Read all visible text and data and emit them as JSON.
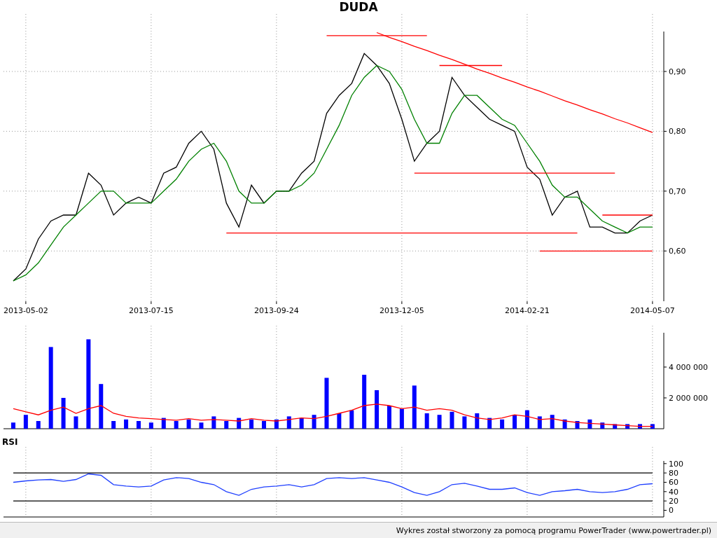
{
  "title": "DUDA",
  "price_panel": {
    "chart_data": {
      "type": "line",
      "grid": true,
      "categories": [
        null,
        "2013-05-02",
        null,
        null,
        null,
        null,
        null,
        null,
        null,
        null,
        null,
        "2013-07-15",
        null,
        null,
        null,
        null,
        null,
        null,
        null,
        null,
        null,
        "2013-09-24",
        null,
        null,
        null,
        null,
        null,
        null,
        null,
        null,
        null,
        "2013-12-05",
        null,
        null,
        null,
        null,
        null,
        null,
        null,
        null,
        null,
        "2014-02-21",
        null,
        null,
        null,
        null,
        null,
        null,
        null,
        null,
        null,
        "2014-05-07"
      ],
      "ylim": [
        0.516,
        0.996
      ],
      "yticks": [
        {
          "value": 0.6,
          "label": "0,60"
        },
        {
          "value": 0.7,
          "label": "0,70"
        },
        {
          "value": 0.8,
          "label": "0,80"
        },
        {
          "value": 0.9,
          "label": "0,90"
        }
      ],
      "series": [
        {
          "color": "#000000",
          "values": [
            0.55,
            0.57,
            0.62,
            0.65,
            0.66,
            0.66,
            0.73,
            0.71,
            0.66,
            0.68,
            0.69,
            0.68,
            0.73,
            0.74,
            0.78,
            0.8,
            0.77,
            0.68,
            0.64,
            0.71,
            0.68,
            0.7,
            0.7,
            0.73,
            0.75,
            0.83,
            0.86,
            0.88,
            0.93,
            0.91,
            0.88,
            0.82,
            0.75,
            0.78,
            0.8,
            0.89,
            0.86,
            0.84,
            0.82,
            0.81,
            0.8,
            0.74,
            0.72,
            0.66,
            0.69,
            0.7,
            0.64,
            0.64,
            0.63,
            0.63,
            0.65,
            0.66
          ]
        },
        {
          "color": "#008000",
          "values": [
            0.55,
            0.56,
            0.58,
            0.61,
            0.64,
            0.66,
            0.68,
            0.7,
            0.7,
            0.68,
            0.68,
            0.68,
            0.7,
            0.72,
            0.75,
            0.77,
            0.78,
            0.75,
            0.7,
            0.68,
            0.68,
            0.7,
            0.7,
            0.71,
            0.73,
            0.77,
            0.81,
            0.86,
            0.89,
            0.91,
            0.9,
            0.87,
            0.82,
            0.78,
            0.78,
            0.83,
            0.86,
            0.86,
            0.84,
            0.82,
            0.81,
            0.78,
            0.75,
            0.71,
            0.69,
            0.69,
            0.67,
            0.65,
            0.64,
            0.63,
            0.64,
            0.64
          ]
        },
        {
          "color": "#ff0000",
          "values": [
            null,
            null,
            null,
            null,
            null,
            null,
            null,
            null,
            null,
            null,
            null,
            null,
            null,
            null,
            null,
            null,
            null,
            null,
            null,
            null,
            null,
            null,
            null,
            null,
            null,
            0.96,
            0.96,
            0.96,
            0.96,
            0.96,
            0.96,
            0.96,
            0.96,
            0.96,
            null,
            null,
            null,
            null,
            null,
            null,
            null,
            null,
            null,
            null,
            null,
            null,
            null,
            null,
            null,
            null,
            null,
            null
          ]
        },
        {
          "color": "#ff0000",
          "values": [
            null,
            null,
            null,
            null,
            null,
            null,
            null,
            null,
            null,
            null,
            null,
            null,
            null,
            null,
            null,
            null,
            null,
            null,
            null,
            null,
            null,
            null,
            null,
            null,
            null,
            null,
            null,
            null,
            null,
            null,
            null,
            null,
            null,
            null,
            0.91,
            0.91,
            0.91,
            0.91,
            0.91,
            0.91,
            null,
            null,
            null,
            null,
            null,
            null,
            null,
            null,
            null,
            null,
            null,
            null
          ]
        },
        {
          "color": "#ff0000",
          "values": [
            null,
            null,
            null,
            null,
            null,
            null,
            null,
            null,
            null,
            null,
            null,
            null,
            null,
            null,
            null,
            null,
            null,
            null,
            null,
            null,
            null,
            null,
            null,
            null,
            null,
            null,
            null,
            null,
            null,
            0.965,
            0.957,
            0.95,
            0.942,
            0.935,
            0.927,
            0.92,
            0.912,
            0.904,
            0.897,
            0.889,
            0.882,
            0.874,
            0.867,
            0.859,
            0.851,
            0.844,
            0.836,
            0.829,
            0.821,
            0.814,
            0.806,
            0.798
          ]
        },
        {
          "color": "#ff0000",
          "values": [
            null,
            null,
            null,
            null,
            null,
            null,
            null,
            null,
            null,
            null,
            null,
            null,
            null,
            null,
            null,
            null,
            null,
            null,
            null,
            null,
            null,
            null,
            null,
            null,
            null,
            null,
            null,
            null,
            null,
            null,
            null,
            null,
            0.73,
            0.73,
            0.73,
            0.73,
            0.73,
            0.73,
            0.73,
            0.73,
            0.73,
            0.73,
            0.73,
            0.73,
            0.73,
            0.73,
            0.73,
            0.73,
            0.73,
            null,
            null,
            null
          ]
        },
        {
          "color": "#ff0000",
          "values": [
            null,
            null,
            null,
            null,
            null,
            null,
            null,
            null,
            null,
            null,
            null,
            null,
            null,
            null,
            null,
            null,
            null,
            0.63,
            0.63,
            0.63,
            0.63,
            0.63,
            0.63,
            0.63,
            0.63,
            0.63,
            0.63,
            0.63,
            0.63,
            0.63,
            0.63,
            0.63,
            0.63,
            0.63,
            0.63,
            0.63,
            0.63,
            0.63,
            0.63,
            0.63,
            0.63,
            0.63,
            0.63,
            0.63,
            0.63,
            0.63,
            null,
            null,
            null,
            null,
            null,
            null
          ]
        },
        {
          "color": "#ff0000",
          "values": [
            null,
            null,
            null,
            null,
            null,
            null,
            null,
            null,
            null,
            null,
            null,
            null,
            null,
            null,
            null,
            null,
            null,
            null,
            null,
            null,
            null,
            null,
            null,
            null,
            null,
            null,
            null,
            null,
            null,
            null,
            null,
            null,
            null,
            null,
            null,
            null,
            null,
            null,
            null,
            null,
            null,
            null,
            null,
            null,
            null,
            null,
            null,
            0.66,
            0.66,
            0.66,
            0.66,
            0.66
          ]
        },
        {
          "color": "#ff0000",
          "values": [
            null,
            null,
            null,
            null,
            null,
            null,
            null,
            null,
            null,
            null,
            null,
            null,
            null,
            null,
            null,
            null,
            null,
            null,
            null,
            null,
            null,
            null,
            null,
            null,
            null,
            null,
            null,
            null,
            null,
            null,
            null,
            null,
            null,
            null,
            null,
            null,
            null,
            null,
            null,
            null,
            null,
            null,
            0.6,
            0.6,
            0.6,
            0.6,
            0.6,
            0.6,
            0.6,
            0.6,
            0.6,
            0.6
          ]
        }
      ]
    }
  },
  "volume_panel": {
    "chart_data": {
      "type": "bar",
      "grid": true,
      "categories": [
        null,
        null,
        null,
        null,
        null,
        null,
        null,
        null,
        null,
        null,
        null,
        null,
        null,
        null,
        null,
        null,
        null,
        null,
        null,
        null,
        null,
        null,
        null,
        null,
        null,
        null,
        null,
        null,
        null,
        null,
        null,
        null,
        null,
        null,
        null,
        null,
        null,
        null,
        null,
        null,
        null,
        null,
        null,
        null,
        null,
        null,
        null,
        null,
        null,
        null,
        null,
        null
      ],
      "ylim": [
        0,
        6680000
      ],
      "yticks": [
        {
          "value": 2000000,
          "label": "2 000 000"
        },
        {
          "value": 4000000,
          "label": "4 000 000"
        }
      ],
      "series": [
        {
          "color": "#0000ff",
          "values": [
            400000,
            900000,
            500000,
            5300000,
            2000000,
            800000,
            5800000,
            2900000,
            500000,
            600000,
            500000,
            400000,
            700000,
            500000,
            600000,
            400000,
            800000,
            500000,
            700000,
            600000,
            500000,
            600000,
            800000,
            700000,
            900000,
            3300000,
            1000000,
            1200000,
            3500000,
            2500000,
            1500000,
            1300000,
            2800000,
            1000000,
            900000,
            1100000,
            800000,
            1000000,
            700000,
            600000,
            900000,
            1200000,
            800000,
            900000,
            600000,
            500000,
            600000,
            400000,
            300000,
            300000,
            300000,
            300000
          ]
        },
        {
          "type": "line",
          "color": "#ff0000",
          "values": [
            1300000,
            1100000,
            900000,
            1200000,
            1400000,
            1000000,
            1300000,
            1500000,
            1000000,
            800000,
            700000,
            650000,
            600000,
            550000,
            650000,
            550000,
            600000,
            550000,
            500000,
            650000,
            550000,
            500000,
            600000,
            700000,
            650000,
            800000,
            1000000,
            1200000,
            1500000,
            1600000,
            1500000,
            1300000,
            1400000,
            1200000,
            1300000,
            1200000,
            900000,
            700000,
            600000,
            700000,
            900000,
            800000,
            600000,
            650000,
            500000,
            400000,
            350000,
            300000,
            250000,
            200000,
            150000,
            150000
          ]
        }
      ]
    }
  },
  "rsi_panel": {
    "label": "RSI",
    "chart_data": {
      "type": "line",
      "grid": true,
      "categories": [
        null,
        null,
        null,
        null,
        null,
        null,
        null,
        null,
        null,
        null,
        null,
        null,
        null,
        null,
        null,
        null,
        null,
        null,
        null,
        null,
        null,
        null,
        null,
        null,
        null,
        null,
        null,
        null,
        null,
        null,
        null,
        null,
        null,
        null,
        null,
        null,
        null,
        null,
        null,
        null,
        null,
        null,
        null,
        null,
        null,
        null,
        null,
        null,
        null,
        null,
        null,
        null
      ],
      "ylim": [
        -14.3,
        135.7
      ],
      "yticks": [
        {
          "value": 0,
          "label": "0"
        },
        {
          "value": 20,
          "label": "20"
        },
        {
          "value": 40,
          "label": "40"
        },
        {
          "value": 60,
          "label": "60"
        },
        {
          "value": 80,
          "label": "80"
        },
        {
          "value": 100,
          "label": "100"
        }
      ],
      "series": [
        {
          "color": "#000000",
          "values": [
            80,
            80,
            80,
            80,
            80,
            80,
            80,
            80,
            80,
            80,
            80,
            80,
            80,
            80,
            80,
            80,
            80,
            80,
            80,
            80,
            80,
            80,
            80,
            80,
            80,
            80,
            80,
            80,
            80,
            80,
            80,
            80,
            80,
            80,
            80,
            80,
            80,
            80,
            80,
            80,
            80,
            80,
            80,
            80,
            80,
            80,
            80,
            80,
            80,
            80,
            80,
            80
          ]
        },
        {
          "color": "#000000",
          "values": [
            20,
            20,
            20,
            20,
            20,
            20,
            20,
            20,
            20,
            20,
            20,
            20,
            20,
            20,
            20,
            20,
            20,
            20,
            20,
            20,
            20,
            20,
            20,
            20,
            20,
            20,
            20,
            20,
            20,
            20,
            20,
            20,
            20,
            20,
            20,
            20,
            20,
            20,
            20,
            20,
            20,
            20,
            20,
            20,
            20,
            20,
            20,
            20,
            20,
            20,
            20,
            20
          ]
        },
        {
          "color": "#2040ff",
          "values": [
            60,
            63,
            65,
            66,
            62,
            66,
            78,
            75,
            55,
            52,
            50,
            52,
            65,
            70,
            68,
            60,
            55,
            40,
            32,
            45,
            50,
            52,
            55,
            50,
            55,
            68,
            70,
            68,
            70,
            65,
            60,
            50,
            38,
            32,
            40,
            55,
            58,
            52,
            45,
            45,
            48,
            38,
            32,
            40,
            42,
            45,
            40,
            38,
            40,
            45,
            55,
            57
          ]
        }
      ]
    }
  },
  "footer": "Wykres został stworzony za pomocą programu PowerTrader (www.powertrader.pl)"
}
